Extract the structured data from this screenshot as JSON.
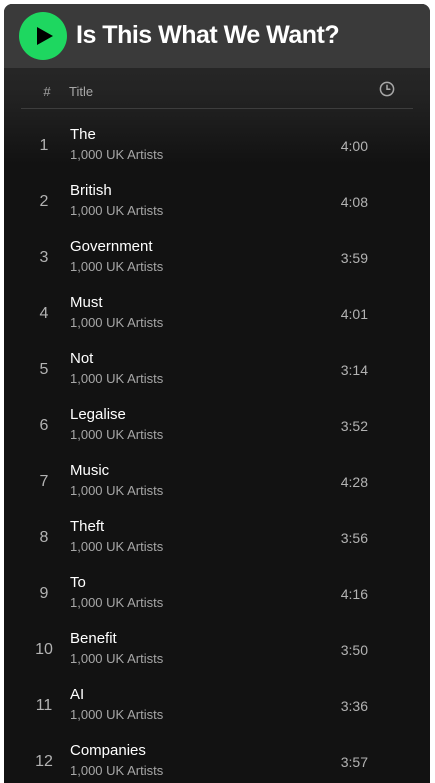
{
  "header": {
    "title": "Is This What We Want?",
    "play_icon": "play-icon",
    "accent_color": "#1ed760"
  },
  "columns": {
    "number": "#",
    "title": "Title",
    "duration_icon": "clock-icon"
  },
  "tracks": [
    {
      "number": "1",
      "name": "The",
      "artist": "1,000 UK Artists",
      "duration": "4:00"
    },
    {
      "number": "2",
      "name": "British",
      "artist": "1,000 UK Artists",
      "duration": "4:08"
    },
    {
      "number": "3",
      "name": "Government",
      "artist": "1,000 UK Artists",
      "duration": "3:59"
    },
    {
      "number": "4",
      "name": "Must",
      "artist": "1,000 UK Artists",
      "duration": "4:01"
    },
    {
      "number": "5",
      "name": "Not",
      "artist": "1,000 UK Artists",
      "duration": "3:14"
    },
    {
      "number": "6",
      "name": "Legalise",
      "artist": "1,000 UK Artists",
      "duration": "3:52"
    },
    {
      "number": "7",
      "name": "Music",
      "artist": "1,000 UK Artists",
      "duration": "4:28"
    },
    {
      "number": "8",
      "name": "Theft",
      "artist": "1,000 UK Artists",
      "duration": "3:56"
    },
    {
      "number": "9",
      "name": "To",
      "artist": "1,000 UK Artists",
      "duration": "4:16"
    },
    {
      "number": "10",
      "name": "Benefit",
      "artist": "1,000 UK Artists",
      "duration": "3:50"
    },
    {
      "number": "11",
      "name": "AI",
      "artist": "1,000 UK Artists",
      "duration": "3:36"
    },
    {
      "number": "12",
      "name": "Companies",
      "artist": "1,000 UK Artists",
      "duration": "3:57"
    }
  ]
}
